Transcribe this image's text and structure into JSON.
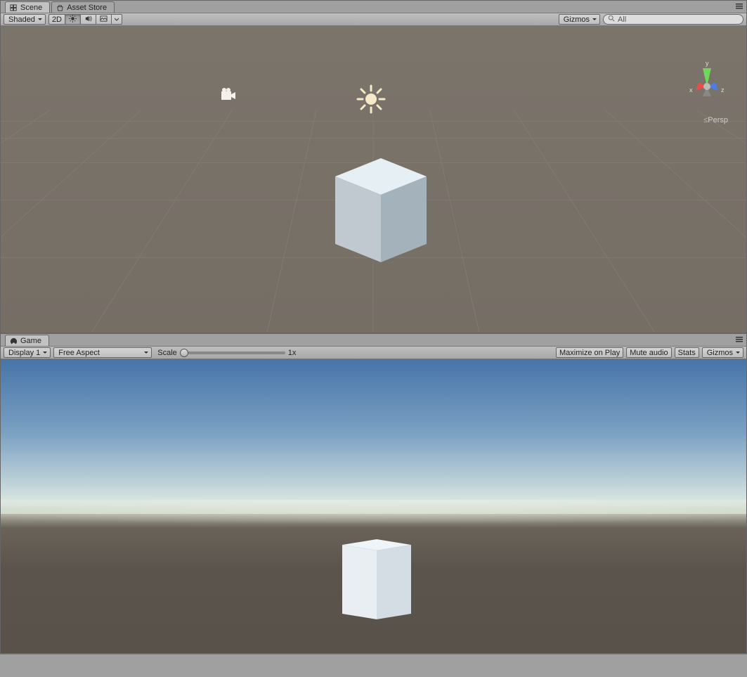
{
  "scene": {
    "tab_scene": "Scene",
    "tab_asset_store": "Asset Store",
    "shading_mode": "Shaded",
    "btn_2d": "2D",
    "gizmos_label": "Gizmos",
    "search_placeholder": "All",
    "persp_label": "Persp",
    "axis": {
      "x": "x",
      "y": "y",
      "z": "z"
    }
  },
  "game": {
    "tab_game": "Game",
    "display": "Display 1",
    "aspect": "Free Aspect",
    "scale_label": "Scale",
    "scale_value": "1x",
    "maximize": "Maximize on Play",
    "mute": "Mute audio",
    "stats": "Stats",
    "gizmos": "Gizmos"
  }
}
